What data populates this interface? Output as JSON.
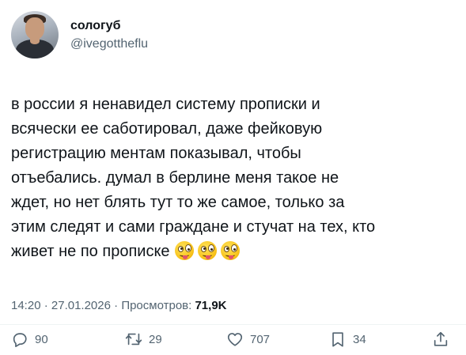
{
  "author": {
    "display_name": "сологуб",
    "handle": "@ivegottheflu"
  },
  "tweet": {
    "text": "в россии я ненавидел систему прописки и\nвсячески ее саботировал, даже фейковую\nрегистрацию ментам показывал, чтобы\nотъебались. думал в берлине меня такое не\nждет, но нет блять тут то же самое, только за\nэтим следят и сами граждане и стучат на тех, кто\nживет не по прописке",
    "emojis": [
      "zany-face-emoji",
      "zany-face-emoji",
      "zany-face-emoji"
    ]
  },
  "meta": {
    "time": "14:20",
    "sep1": "·",
    "date": "27.01.2026",
    "sep2": "·",
    "views_label": "Просмотров:",
    "views_count": "71,9K"
  },
  "actions": {
    "replies": "90",
    "retweets": "29",
    "likes": "707",
    "bookmarks": "34"
  },
  "colors": {
    "text": "#0f1419",
    "secondary": "#536471",
    "divider": "#eff3f4"
  }
}
